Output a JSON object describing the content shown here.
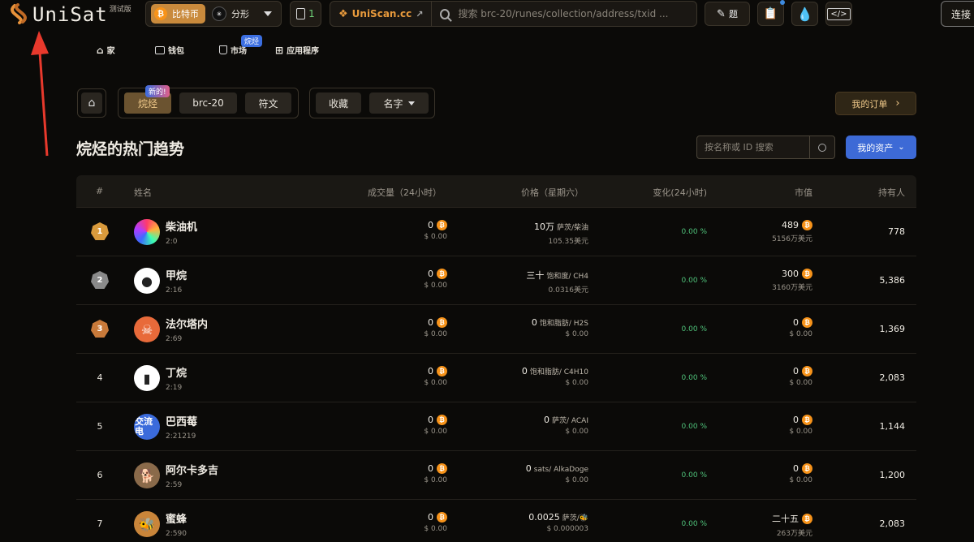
{
  "header": {
    "logo_text": "UniSat",
    "logo_badge": "测试版",
    "network_label": "比特币",
    "network_variant": "分形",
    "gas_value": "1",
    "uniscan_label": "UniScan.cc",
    "search_placeholder": "搜索 brc-20/runes/collection/address/txid ...",
    "fire_button_label": "题",
    "connect_label": "连接"
  },
  "nav": {
    "items": [
      {
        "label": "家",
        "icon": "home-icon"
      },
      {
        "label": "钱包",
        "icon": "wallet-icon"
      },
      {
        "label": "市场",
        "icon": "shopping-bag-icon"
      },
      {
        "label": "应用程序",
        "icon": "apps-grid-icon"
      }
    ],
    "market_badge": "烷烃"
  },
  "tabs": {
    "group1": [
      {
        "label": "烷烃",
        "active": true,
        "badge": "新的!"
      },
      {
        "label": "brc-20",
        "active": false
      },
      {
        "label": "符文",
        "active": false
      }
    ],
    "group2": [
      {
        "label": "收藏"
      },
      {
        "label": "名字"
      }
    ]
  },
  "my_order_label": "我的订单",
  "page_title": "烷烃的热门趋势",
  "asset_search_placeholder": "按名称或 ID 搜索",
  "my_assets_label": "我的资产",
  "table": {
    "columns": [
      "#",
      "姓名",
      "成交量（24小时）",
      "价格（星期六）",
      "变化(24小时)",
      "市值",
      "持有人"
    ],
    "rows": [
      {
        "rank": "1",
        "name": "柴油机",
        "id": "2:0",
        "volume": "0",
        "volume_usd": "$ 0.00",
        "price": "10万",
        "price_unit": "萨茨/柴油",
        "price_usd": "105.35美元",
        "change": "0.00 %",
        "mcap": "489",
        "mcap_usd": "5156万美元",
        "holders": "778"
      },
      {
        "rank": "2",
        "name": "甲烷",
        "id": "2:16",
        "volume": "0",
        "volume_usd": "$ 0.00",
        "price": "三十",
        "price_unit": "饱和度/ CH4",
        "price_usd": "0.0316美元",
        "change": "0.00 %",
        "mcap": "300",
        "mcap_usd": "3160万美元",
        "holders": "5,386"
      },
      {
        "rank": "3",
        "name": "法尔塔内",
        "id": "2:69",
        "volume": "0",
        "volume_usd": "$ 0.00",
        "price": "0",
        "price_unit": "饱和脂肪/ H2S",
        "price_usd": "$ 0.00",
        "change": "0.00 %",
        "mcap": "0",
        "mcap_usd": "$ 0.00",
        "holders": "1,369"
      },
      {
        "rank": "4",
        "name": "丁烷",
        "id": "2:19",
        "volume": "0",
        "volume_usd": "$ 0.00",
        "price": "0",
        "price_unit": "饱和脂肪/ C4H10",
        "price_usd": "$ 0.00",
        "change": "0.00 %",
        "mcap": "0",
        "mcap_usd": "$ 0.00",
        "holders": "2,083"
      },
      {
        "rank": "5",
        "name": "巴西莓",
        "id": "2:21219",
        "avatar_text": "交流电",
        "volume": "0",
        "volume_usd": "$ 0.00",
        "price": "0",
        "price_unit": "萨茨/ ACAI",
        "price_usd": "$ 0.00",
        "change": "0.00 %",
        "mcap": "0",
        "mcap_usd": "$ 0.00",
        "holders": "1,144"
      },
      {
        "rank": "6",
        "name": "阿尔卡多吉",
        "id": "2:59",
        "volume": "0",
        "volume_usd": "$ 0.00",
        "price": "0",
        "price_unit": "sats/ AlkaDoge",
        "price_usd": "$ 0.00",
        "change": "0.00 %",
        "mcap": "0",
        "mcap_usd": "$ 0.00",
        "holders": "1,200"
      },
      {
        "rank": "7",
        "name": "蜜蜂",
        "id": "2:590",
        "volume": "0",
        "volume_usd": "$ 0.00",
        "price": "0.0025",
        "price_unit": "萨茨/🐝",
        "price_usd": "$ 0.000003",
        "change": "0.00 %",
        "mcap": "二十五",
        "mcap_usd": "263万美元",
        "holders": "2,083"
      }
    ]
  },
  "colors": {
    "accent": "#c98a3c",
    "bitcoin": "#f7931a",
    "positive": "#4fc27a",
    "primary_blue": "#3d6ad6",
    "annotation_arrow": "#e8392c"
  }
}
